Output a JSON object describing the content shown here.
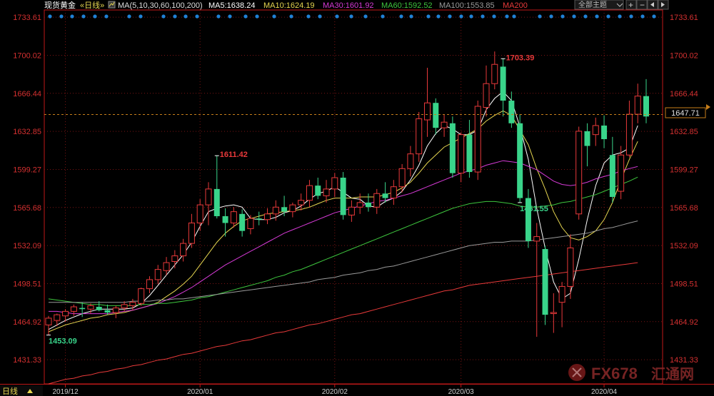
{
  "header": {
    "symbol": "现货黄金",
    "period": "«日线»",
    "ma_spec": "MA(5,10,30,60,100,200)",
    "ma_values": [
      {
        "label": "MA5:1638.24",
        "color": "#ffffff"
      },
      {
        "label": "MA10:1624.19",
        "color": "#e6d650"
      },
      {
        "label": "MA30:1601.92",
        "color": "#d63ad6"
      },
      {
        "label": "MA60:1592.52",
        "color": "#3ec63e"
      },
      {
        "label": "MA100:1553.85",
        "color": "#9a9a9a"
      },
      {
        "label": "MA200",
        "color": "#e83a3a"
      }
    ],
    "theme_button": "全部主题",
    "theme_icon": "chevron-down-icon"
  },
  "bottom_bar": {
    "period_label": "日线",
    "toggle_icon": "triangle-up-icon"
  },
  "watermark": {
    "text": "FX678",
    "sub": "汇通网"
  },
  "colors": {
    "up": "#e8393a",
    "down": "#39d48a",
    "grid": "#7a1414",
    "axis": "#c01818",
    "price_text": "#d43030",
    "current_line": "#c77e1a",
    "event_dot": "#1e82d6"
  },
  "chart_data": {
    "type": "candlestick",
    "instrument": "现货黄金",
    "period": "日线",
    "y_ticks": [
      1733.61,
      1700.02,
      1666.44,
      1632.85,
      1599.27,
      1565.68,
      1532.09,
      1498.51,
      1464.92,
      1431.33
    ],
    "ylim": [
      1410,
      1740
    ],
    "x_ticks": [
      {
        "label": "2019/12",
        "index": 2
      },
      {
        "label": "2020/01",
        "index": 18
      },
      {
        "label": "2020/02",
        "index": 34
      },
      {
        "label": "2020/03",
        "index": 49
      },
      {
        "label": "2020/04",
        "index": 66
      }
    ],
    "current_price": 1647.71,
    "annotations": [
      {
        "text": "1453.09",
        "index": 0,
        "type": "low"
      },
      {
        "text": "1611.42",
        "index": 20,
        "type": "high"
      },
      {
        "text": "1703.39",
        "index": 54,
        "type": "high"
      },
      {
        "text": "1451.55",
        "index": 56,
        "type": "low"
      }
    ],
    "event_dots": [
      0,
      1,
      2,
      3,
      4,
      5,
      6,
      7,
      8,
      9,
      10,
      11,
      12,
      13,
      14,
      15,
      16,
      17,
      18,
      19,
      20,
      21,
      22,
      23,
      24,
      25,
      26,
      27,
      28,
      29,
      30,
      31,
      32,
      33,
      34,
      35,
      36,
      37,
      38,
      39,
      40,
      41,
      42,
      43,
      44,
      45,
      46,
      47,
      48,
      49,
      50,
      51,
      52,
      53,
      54,
      55,
      56,
      57,
      58,
      59,
      60,
      61,
      62,
      63,
      64,
      65,
      66,
      67,
      68,
      69,
      70
    ],
    "candles": [
      {
        "o": 1462,
        "h": 1470,
        "l": 1453.09,
        "c": 1468
      },
      {
        "o": 1466,
        "h": 1472,
        "l": 1461,
        "c": 1471
      },
      {
        "o": 1470,
        "h": 1476,
        "l": 1465,
        "c": 1474
      },
      {
        "o": 1474,
        "h": 1480,
        "l": 1470,
        "c": 1478
      },
      {
        "o": 1477,
        "h": 1482,
        "l": 1469,
        "c": 1476
      },
      {
        "o": 1476,
        "h": 1481,
        "l": 1472,
        "c": 1479
      },
      {
        "o": 1478,
        "h": 1483,
        "l": 1474,
        "c": 1475
      },
      {
        "o": 1475,
        "h": 1480,
        "l": 1471,
        "c": 1473
      },
      {
        "o": 1473,
        "h": 1479,
        "l": 1468,
        "c": 1477
      },
      {
        "o": 1477,
        "h": 1483,
        "l": 1474,
        "c": 1480
      },
      {
        "o": 1479,
        "h": 1485,
        "l": 1475,
        "c": 1482
      },
      {
        "o": 1481,
        "h": 1495,
        "l": 1479,
        "c": 1494
      },
      {
        "o": 1494,
        "h": 1505,
        "l": 1490,
        "c": 1502
      },
      {
        "o": 1502,
        "h": 1515,
        "l": 1498,
        "c": 1511
      },
      {
        "o": 1510,
        "h": 1522,
        "l": 1506,
        "c": 1517
      },
      {
        "o": 1518,
        "h": 1528,
        "l": 1512,
        "c": 1523
      },
      {
        "o": 1523,
        "h": 1538,
        "l": 1518,
        "c": 1534
      },
      {
        "o": 1534,
        "h": 1560,
        "l": 1530,
        "c": 1552
      },
      {
        "o": 1552,
        "h": 1573,
        "l": 1545,
        "c": 1568
      },
      {
        "o": 1568,
        "h": 1588,
        "l": 1550,
        "c": 1582
      },
      {
        "o": 1582,
        "h": 1611.42,
        "l": 1556,
        "c": 1558
      },
      {
        "o": 1558,
        "h": 1565,
        "l": 1540,
        "c": 1552
      },
      {
        "o": 1552,
        "h": 1566,
        "l": 1548,
        "c": 1562
      },
      {
        "o": 1560,
        "h": 1564,
        "l": 1540,
        "c": 1545
      },
      {
        "o": 1547,
        "h": 1559,
        "l": 1542,
        "c": 1556
      },
      {
        "o": 1556,
        "h": 1562,
        "l": 1550,
        "c": 1555
      },
      {
        "o": 1555,
        "h": 1565,
        "l": 1551,
        "c": 1560
      },
      {
        "o": 1560,
        "h": 1572,
        "l": 1554,
        "c": 1566
      },
      {
        "o": 1566,
        "h": 1576,
        "l": 1558,
        "c": 1562
      },
      {
        "o": 1562,
        "h": 1570,
        "l": 1557,
        "c": 1568
      },
      {
        "o": 1568,
        "h": 1578,
        "l": 1563,
        "c": 1572
      },
      {
        "o": 1572,
        "h": 1590,
        "l": 1566,
        "c": 1585
      },
      {
        "o": 1585,
        "h": 1592,
        "l": 1573,
        "c": 1576
      },
      {
        "o": 1576,
        "h": 1590,
        "l": 1570,
        "c": 1582
      },
      {
        "o": 1582,
        "h": 1596,
        "l": 1575,
        "c": 1592
      },
      {
        "o": 1592,
        "h": 1597,
        "l": 1555,
        "c": 1559
      },
      {
        "o": 1559,
        "h": 1572,
        "l": 1553,
        "c": 1566
      },
      {
        "o": 1566,
        "h": 1578,
        "l": 1560,
        "c": 1570
      },
      {
        "o": 1570,
        "h": 1578,
        "l": 1562,
        "c": 1566
      },
      {
        "o": 1566,
        "h": 1582,
        "l": 1560,
        "c": 1578
      },
      {
        "o": 1578,
        "h": 1588,
        "l": 1570,
        "c": 1574
      },
      {
        "o": 1574,
        "h": 1590,
        "l": 1568,
        "c": 1584
      },
      {
        "o": 1584,
        "h": 1604,
        "l": 1579,
        "c": 1600
      },
      {
        "o": 1600,
        "h": 1620,
        "l": 1593,
        "c": 1613
      },
      {
        "o": 1613,
        "h": 1650,
        "l": 1606,
        "c": 1644
      },
      {
        "o": 1643,
        "h": 1689,
        "l": 1628,
        "c": 1658
      },
      {
        "o": 1658,
        "h": 1662,
        "l": 1630,
        "c": 1636
      },
      {
        "o": 1636,
        "h": 1648,
        "l": 1628,
        "c": 1641
      },
      {
        "o": 1640,
        "h": 1646,
        "l": 1592,
        "c": 1596
      },
      {
        "o": 1596,
        "h": 1632,
        "l": 1588,
        "c": 1630
      },
      {
        "o": 1630,
        "h": 1643,
        "l": 1592,
        "c": 1597
      },
      {
        "o": 1597,
        "h": 1660,
        "l": 1590,
        "c": 1655
      },
      {
        "o": 1654,
        "h": 1691,
        "l": 1646,
        "c": 1675
      },
      {
        "o": 1675,
        "h": 1703.39,
        "l": 1670,
        "c": 1692
      },
      {
        "o": 1690,
        "h": 1697,
        "l": 1646,
        "c": 1660
      },
      {
        "o": 1660,
        "h": 1668,
        "l": 1636,
        "c": 1640
      },
      {
        "o": 1640,
        "h": 1648,
        "l": 1570,
        "c": 1574
      },
      {
        "o": 1574,
        "h": 1582,
        "l": 1530,
        "c": 1536
      },
      {
        "o": 1536,
        "h": 1552,
        "l": 1451.55,
        "c": 1540
      },
      {
        "o": 1529,
        "h": 1532,
        "l": 1462,
        "c": 1471
      },
      {
        "o": 1472,
        "h": 1490,
        "l": 1455,
        "c": 1473
      },
      {
        "o": 1482,
        "h": 1500,
        "l": 1460,
        "c": 1496
      },
      {
        "o": 1496,
        "h": 1542,
        "l": 1485,
        "c": 1530
      },
      {
        "o": 1560,
        "h": 1637,
        "l": 1555,
        "c": 1633
      },
      {
        "o": 1633,
        "h": 1640,
        "l": 1602,
        "c": 1620
      },
      {
        "o": 1630,
        "h": 1645,
        "l": 1620,
        "c": 1638
      },
      {
        "o": 1638,
        "h": 1647,
        "l": 1618,
        "c": 1626
      },
      {
        "o": 1612,
        "h": 1628,
        "l": 1570,
        "c": 1575
      },
      {
        "o": 1580,
        "h": 1620,
        "l": 1573,
        "c": 1612
      },
      {
        "o": 1612,
        "h": 1660,
        "l": 1610,
        "c": 1648
      },
      {
        "o": 1648,
        "h": 1675,
        "l": 1640,
        "c": 1664
      },
      {
        "o": 1664,
        "h": 1679,
        "l": 1640,
        "c": 1646
      }
    ],
    "ma_lines": [
      {
        "name": "MA5",
        "color": "#ffffff",
        "values": [
          1458,
          1462,
          1466,
          1469,
          1472,
          1474,
          1476,
          1476,
          1476,
          1476,
          1477,
          1481,
          1488,
          1497,
          1506,
          1515,
          1524,
          1535,
          1549,
          1562,
          1565,
          1567,
          1568,
          1566,
          1556,
          1555,
          1555,
          1557,
          1561,
          1563,
          1567,
          1573,
          1578,
          1580,
          1584,
          1579,
          1574,
          1573,
          1567,
          1566,
          1571,
          1574,
          1580,
          1590,
          1603,
          1620,
          1631,
          1638,
          1635,
          1630,
          1630,
          1634,
          1652,
          1662,
          1668,
          1660,
          1637,
          1608,
          1565,
          1530,
          1500,
          1485,
          1490,
          1520,
          1555,
          1585,
          1605,
          1612,
          1614,
          1618,
          1638
        ]
      },
      {
        "name": "MA10",
        "color": "#e6d650",
        "values": [
          1456,
          1459,
          1462,
          1464,
          1466,
          1468,
          1469,
          1471,
          1472,
          1473,
          1475,
          1477,
          1479,
          1482,
          1487,
          1492,
          1498,
          1505,
          1515,
          1525,
          1535,
          1543,
          1549,
          1554,
          1556,
          1558,
          1560,
          1561,
          1562,
          1563,
          1564,
          1566,
          1569,
          1572,
          1574,
          1574,
          1574,
          1575,
          1575,
          1575,
          1577,
          1579,
          1583,
          1588,
          1596,
          1605,
          1612,
          1619,
          1623,
          1627,
          1631,
          1635,
          1642,
          1647,
          1651,
          1647,
          1634,
          1621,
          1600,
          1582,
          1562,
          1548,
          1539,
          1537,
          1540,
          1545,
          1555,
          1570,
          1590,
          1608,
          1624
        ]
      },
      {
        "name": "MA30",
        "color": "#d63ad6",
        "values": [
          1474,
          1474,
          1473,
          1472,
          1472,
          1472,
          1472,
          1472,
          1473,
          1474,
          1475,
          1477,
          1479,
          1481,
          1484,
          1487,
          1491,
          1495,
          1500,
          1505,
          1510,
          1515,
          1519,
          1523,
          1527,
          1531,
          1535,
          1539,
          1543,
          1546,
          1549,
          1552,
          1555,
          1558,
          1561,
          1563,
          1565,
          1567,
          1569,
          1571,
          1572,
          1574,
          1576,
          1578,
          1581,
          1584,
          1587,
          1590,
          1593,
          1596,
          1598,
          1600,
          1603,
          1605,
          1607,
          1606,
          1605,
          1602,
          1599,
          1594,
          1589,
          1586,
          1585,
          1586,
          1588,
          1591,
          1593,
          1595,
          1598,
          1600,
          1601.92
        ]
      },
      {
        "name": "MA60",
        "color": "#3ec63e",
        "values": [
          1485,
          1484,
          1483,
          1482,
          1481,
          1480,
          1480,
          1479,
          1479,
          1479,
          1479,
          1480,
          1480,
          1481,
          1481,
          1482,
          1483,
          1484,
          1486,
          1487,
          1489,
          1491,
          1493,
          1495,
          1497,
          1499,
          1501,
          1504,
          1506,
          1509,
          1511,
          1514,
          1517,
          1520,
          1523,
          1526,
          1529,
          1532,
          1535,
          1538,
          1541,
          1544,
          1547,
          1550,
          1553,
          1556,
          1559,
          1562,
          1565,
          1567,
          1569,
          1570,
          1571,
          1571,
          1570,
          1569,
          1567,
          1566,
          1566,
          1567,
          1568,
          1570,
          1571,
          1573,
          1575,
          1577,
          1580,
          1583,
          1586,
          1589,
          1592.52
        ]
      },
      {
        "name": "MA100",
        "color": "#9a9a9a",
        "values": [
          1482,
          1482,
          1482,
          1482,
          1482,
          1482,
          1482,
          1482,
          1482,
          1482,
          1483,
          1483,
          1483,
          1484,
          1484,
          1485,
          1485,
          1486,
          1487,
          1488,
          1489,
          1490,
          1491,
          1492,
          1493,
          1494,
          1495,
          1496,
          1497,
          1498,
          1499,
          1500,
          1502,
          1503,
          1504,
          1506,
          1507,
          1508,
          1510,
          1511,
          1513,
          1514,
          1516,
          1518,
          1520,
          1522,
          1524,
          1526,
          1528,
          1530,
          1532,
          1533,
          1534,
          1535,
          1535,
          1536,
          1536,
          1536,
          1537,
          1538,
          1539,
          1540,
          1541,
          1542,
          1543,
          1545,
          1547,
          1548,
          1550,
          1552,
          1553.85
        ]
      },
      {
        "name": "MA200",
        "color": "#e83a3a",
        "values": [
          1410,
          1412,
          1414,
          1415,
          1417,
          1418,
          1420,
          1421,
          1423,
          1424,
          1426,
          1427,
          1429,
          1431,
          1432,
          1434,
          1436,
          1437,
          1439,
          1441,
          1443,
          1444,
          1446,
          1448,
          1449,
          1451,
          1453,
          1455,
          1456,
          1458,
          1460,
          1462,
          1463,
          1465,
          1467,
          1469,
          1471,
          1472,
          1474,
          1476,
          1478,
          1480,
          1482,
          1484,
          1486,
          1488,
          1490,
          1492,
          1493,
          1495,
          1497,
          1498,
          1499,
          1500,
          1501,
          1502,
          1503,
          1504,
          1505,
          1506,
          1507,
          1508,
          1509,
          1510,
          1511,
          1512,
          1513,
          1514,
          1515,
          1516,
          1517
        ]
      }
    ]
  }
}
